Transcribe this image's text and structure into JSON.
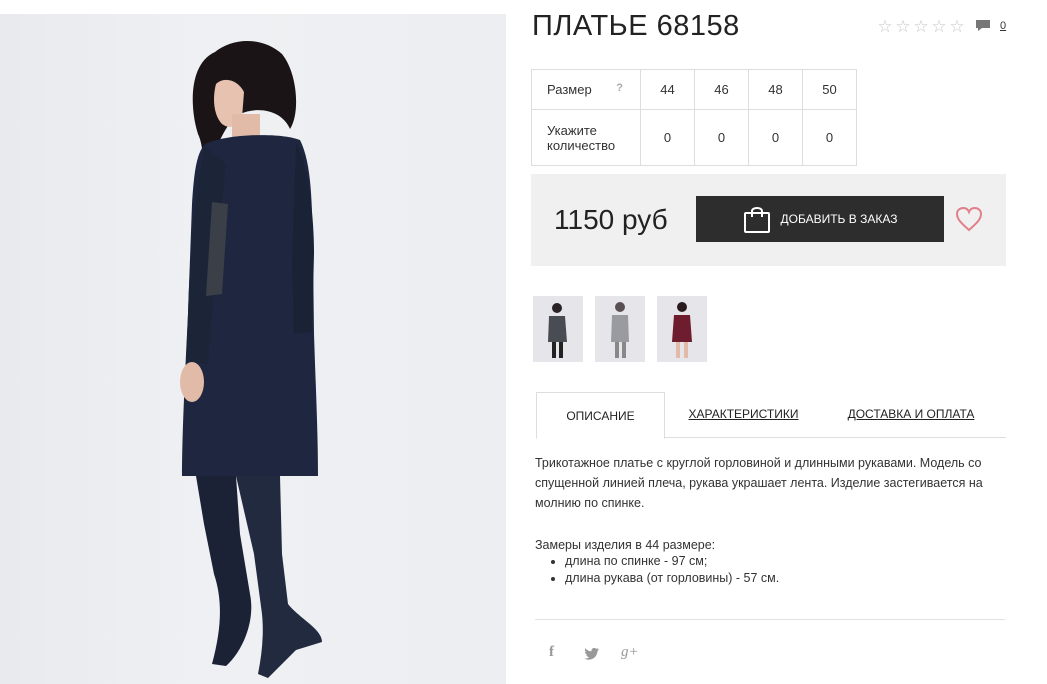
{
  "product": {
    "title": "ПЛАТЬЕ 68158",
    "rating_stars": 5,
    "comment_count": "0"
  },
  "sizes": {
    "size_label": "Размер",
    "help": "?",
    "qty_label": "Укажите количество",
    "columns": [
      "44",
      "46",
      "48",
      "50"
    ],
    "quantities": [
      "0",
      "0",
      "0",
      "0"
    ]
  },
  "purchase": {
    "price": "1150 руб",
    "add_label": "ДОБАВИТЬ В ЗАКАЗ"
  },
  "tabs": [
    {
      "label": "ОПИСАНИЕ",
      "active": true
    },
    {
      "label": "ХАРАКТЕРИСТИКИ",
      "active": false
    },
    {
      "label": "ДОСТАВКА И ОПЛАТА",
      "active": false
    }
  ],
  "description": {
    "text": "Трикотажное платье с круглой горловиной и длинными рукавами. Модель со спущенной линией плеча, рукава украшает лента. Изделие застегивается на молнию по спинке.",
    "measure_title": "Замеры изделия в 44 размере:",
    "measures": [
      "длина по спинке - 97 см;",
      "длина рукава (от горловины) - 57 см."
    ]
  },
  "social": {
    "facebook": "f",
    "twitter": "twitter-bird",
    "google": "g+"
  },
  "colors": {
    "accent_dark": "#2d2d2d",
    "heart": "#e0808a",
    "price_bg": "#f0f0f0"
  }
}
